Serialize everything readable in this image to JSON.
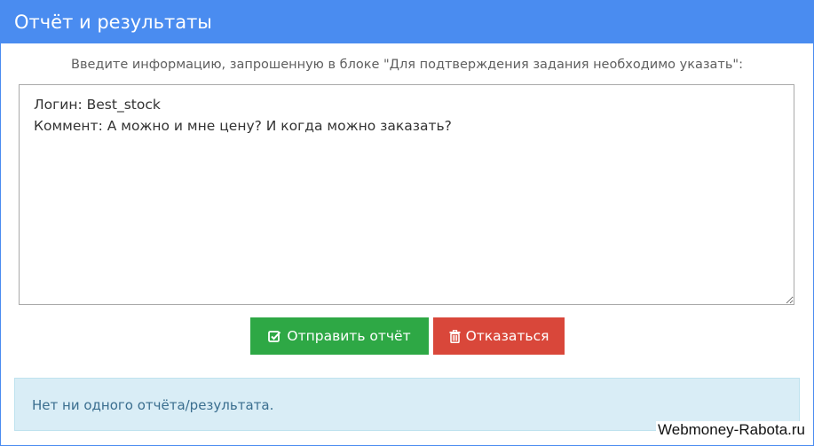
{
  "panel": {
    "title": "Отчёт и результаты",
    "instruction": "Введите информацию, запрошенную в блоке \"Для подтверждения задания необходимо указать\":",
    "report_text": "Логин: Best_stock\nКоммент: А можно и мне цену? И когда можно заказать?"
  },
  "buttons": {
    "submit_label": "Отправить отчёт",
    "submit_icon": "check-square-icon",
    "refuse_label": "Отказаться",
    "refuse_icon": "trash-icon"
  },
  "results": {
    "empty_message": "Нет ни одного отчёта/результата."
  },
  "watermark": "Webmoney-Rabota.ru",
  "colors": {
    "header": "#4a8cf0",
    "submit": "#2ea845",
    "refuse": "#d9473a",
    "alert_bg": "#d9edf6",
    "alert_text": "#3a6e8f"
  }
}
